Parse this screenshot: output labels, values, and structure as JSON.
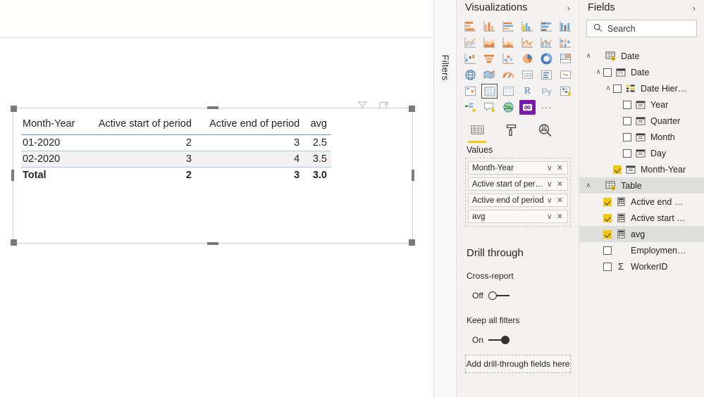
{
  "canvas": {
    "visual_header": {
      "filter_icon": "filter-funnel-icon",
      "focus_icon": "focus-mode-icon",
      "more_icon": "more-options-icon",
      "more_label": "…"
    },
    "table_visual": {
      "columns": [
        "Month-Year",
        "Active start of period",
        "Active end of period",
        "avg"
      ],
      "rows": [
        [
          "01-2020",
          "2",
          "3",
          "2.5"
        ],
        [
          "02-2020",
          "3",
          "4",
          "3.5"
        ]
      ],
      "total_row": [
        "Total",
        "2",
        "3",
        "3.0"
      ]
    }
  },
  "filters_pane": {
    "label": "Filters"
  },
  "visualizations": {
    "title": "Visualizations",
    "collapse_icon": "chevron-right-icon",
    "gallery": [
      "stacked-bar-chart-icon",
      "stacked-column-chart-icon",
      "clustered-bar-chart-icon",
      "clustered-column-chart-icon",
      "100-stacked-bar-chart-icon",
      "100-stacked-column-chart-icon",
      "line-chart-icon",
      "area-chart-icon",
      "stacked-area-chart-icon",
      "line-stacked-column-chart-icon",
      "line-clustered-column-chart-icon",
      "ribbon-chart-icon",
      "waterfall-chart-icon",
      "funnel-chart-icon",
      "scatter-chart-icon",
      "pie-chart-icon",
      "donut-chart-icon",
      "treemap-icon",
      "map-icon",
      "filled-map-icon",
      "gauge-chart-icon",
      "card-icon",
      "multi-row-card-icon",
      "kpi-icon",
      "slicer-icon",
      "table-icon",
      "matrix-icon",
      "r-script-visual-icon",
      "python-visual-icon",
      "key-influencers-icon",
      "decomposition-tree-icon",
      "qna-visual-icon",
      "arcgis-map-icon",
      "custom-visual-icon",
      "more-visuals-icon"
    ],
    "selected_visual": "table-icon",
    "highlighted_visual": "custom-visual-icon",
    "more_visuals_label": "···",
    "tabs": [
      {
        "name": "fields-tab",
        "icon": "fields-pane-icon",
        "active": true
      },
      {
        "name": "format-tab",
        "icon": "paint-roller-icon",
        "active": false
      },
      {
        "name": "analytics-tab",
        "icon": "analytics-magnifier-icon",
        "active": false
      }
    ],
    "wells_label": "Values",
    "wells": [
      {
        "name": "Month-Year"
      },
      {
        "name": "Active start of period"
      },
      {
        "name": "Active end of period"
      },
      {
        "name": "avg"
      }
    ],
    "well_chevron": "∨",
    "well_remove": "✕",
    "drill_through": {
      "title": "Drill through",
      "cross_report_label": "Cross-report",
      "cross_report_state": "Off",
      "keep_filters_label": "Keep all filters",
      "keep_filters_state": "On",
      "drop_zone_label": "Add drill-through fields here"
    }
  },
  "fields": {
    "title": "Fields",
    "collapse_icon": "chevron-right-icon",
    "search": {
      "placeholder": "Search",
      "value": "",
      "icon": "search-icon"
    },
    "tree": [
      {
        "label": "Date",
        "icon": "table-with-badge-icon",
        "indent": 0,
        "chevron": "∧",
        "checkbox": "none",
        "highlighted": false
      },
      {
        "label": "Date",
        "icon": "calendar-icon",
        "indent": 1,
        "chevron": "∧",
        "checkbox": "unchecked",
        "highlighted": false
      },
      {
        "label": "Date Hier…",
        "icon": "hierarchy-icon",
        "indent": 2,
        "chevron": "∧",
        "checkbox": "unchecked",
        "highlighted": false
      },
      {
        "label": "Year",
        "icon": "date-field-icon",
        "indent": 3,
        "chevron": "none",
        "checkbox": "unchecked",
        "highlighted": false
      },
      {
        "label": "Quarter",
        "icon": "date-field-icon",
        "indent": 3,
        "chevron": "none",
        "checkbox": "unchecked",
        "highlighted": false
      },
      {
        "label": "Month",
        "icon": "date-field-icon",
        "indent": 3,
        "chevron": "none",
        "checkbox": "unchecked",
        "highlighted": false
      },
      {
        "label": "Day",
        "icon": "date-field-icon",
        "indent": 3,
        "chevron": "none",
        "checkbox": "unchecked",
        "highlighted": false
      },
      {
        "label": "Month-Year",
        "icon": "date-field-icon",
        "indent": 2,
        "chevron": "none",
        "checkbox": "checked",
        "highlighted": false
      },
      {
        "label": "Table",
        "icon": "table-with-badge-icon",
        "indent": 0,
        "chevron": "∧",
        "checkbox": "none",
        "highlighted": true
      },
      {
        "label": "Active end …",
        "icon": "measure-icon",
        "indent": 1,
        "chevron": "none",
        "checkbox": "checked",
        "highlighted": false
      },
      {
        "label": "Active start …",
        "icon": "measure-icon",
        "indent": 1,
        "chevron": "none",
        "checkbox": "checked",
        "highlighted": false
      },
      {
        "label": "avg",
        "icon": "measure-icon",
        "indent": 1,
        "chevron": "none",
        "checkbox": "checked",
        "highlighted": true
      },
      {
        "label": "Employmen…",
        "icon": "none",
        "indent": 1,
        "chevron": "none",
        "checkbox": "unchecked",
        "highlighted": false
      },
      {
        "label": "WorkerID",
        "icon": "sigma-icon",
        "indent": 1,
        "chevron": "none",
        "checkbox": "unchecked",
        "highlighted": false
      }
    ]
  },
  "colors": {
    "accent_yellow": "#f2c811",
    "purple_custom": "#7719aa",
    "table_rule_blue": "#4ba3e3",
    "pane_bg": "#f3f2f1"
  }
}
